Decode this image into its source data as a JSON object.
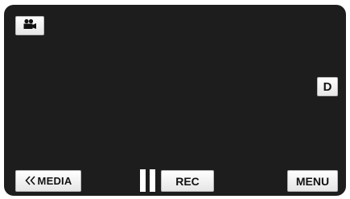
{
  "top_left": {
    "mode_icon": "video-camera-icon"
  },
  "right": {
    "d_label": "D"
  },
  "bottom": {
    "media_label": "MEDIA",
    "media_icon": "double-chevron-left-icon",
    "pause_icon": "pause-icon",
    "rec_label": "REC",
    "menu_label": "MENU"
  },
  "colors": {
    "screen_bg": "#1d1d1d",
    "button_bg": "#ffffff",
    "button_text": "#111111"
  }
}
